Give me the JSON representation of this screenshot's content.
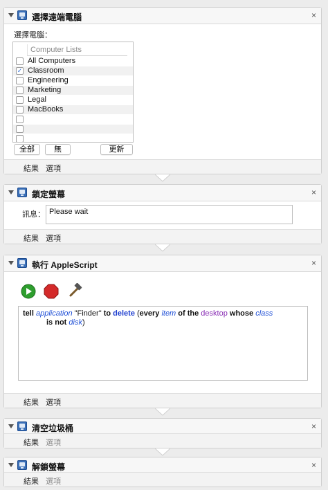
{
  "actions": {
    "select_remote": {
      "title": "選擇遠端電腦",
      "select_label": "選擇電腦：",
      "list_header": "Computer Lists",
      "items": [
        {
          "label": "All Computers",
          "checked": false
        },
        {
          "label": "Classroom",
          "checked": true
        },
        {
          "label": "Engineering",
          "checked": false
        },
        {
          "label": "Marketing",
          "checked": false
        },
        {
          "label": "Legal",
          "checked": false
        },
        {
          "label": "MacBooks",
          "checked": false
        },
        {
          "label": "",
          "checked": false
        },
        {
          "label": "",
          "checked": false
        },
        {
          "label": "",
          "checked": false
        }
      ],
      "check_mark": "✓",
      "all_button": "全部",
      "none_button": "無",
      "update_button": "更新",
      "results": "結果",
      "options": "選項"
    },
    "lock_screen": {
      "title": "鎖定螢幕",
      "message_label": "訊息：",
      "message_value": "Please wait",
      "results": "結果",
      "options": "選項"
    },
    "applescript": {
      "title": "執行 AppleScript",
      "code": {
        "tell": "tell",
        "application": "application",
        "finder": "\"Finder\"",
        "to": "to",
        "delete": "delete",
        "paren_open": "(",
        "every": "every",
        "item": "item",
        "of_the": "of the",
        "desktop": "desktop",
        "whose": "whose",
        "class": "class",
        "is_not": "is not",
        "disk": "disk",
        "paren_close": ")"
      },
      "results": "結果",
      "options": "選項"
    },
    "empty_trash": {
      "title": "清空垃圾桶",
      "results": "結果",
      "options": "選項"
    },
    "unlock_screen": {
      "title": "解鎖螢幕",
      "results": "結果",
      "options": "選項"
    }
  },
  "close_glyph": "×",
  "colors": {
    "run_button": "#2e9e2e",
    "stop_button": "#d42a2a",
    "keyword_blue": "#1f3fcf",
    "term_purple": "#8a2fb5"
  },
  "icons": [
    "disclosure-triangle-icon",
    "action-icon",
    "close-icon",
    "run-icon",
    "stop-icon",
    "compile-hammer-icon"
  ]
}
